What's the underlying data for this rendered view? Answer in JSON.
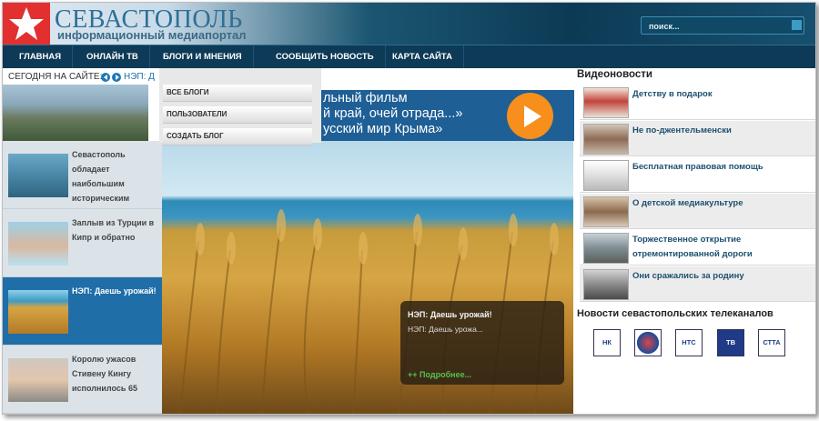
{
  "header": {
    "site_title": "СЕВАСТОПОЛЬ",
    "site_subtitle": "информационный медиапортал",
    "search": {
      "placeholder": "поиск..."
    }
  },
  "nav": {
    "items": [
      {
        "label": "ГЛАВНАЯ"
      },
      {
        "label": "ОНЛАЙН ТВ"
      },
      {
        "label": "БЛОГИ И МНЕНИЯ"
      },
      {
        "label": "СООБЩИТЬ НОВОСТЬ"
      },
      {
        "label": "КАРТА САЙТА"
      }
    ]
  },
  "today": {
    "label": "СЕГОДНЯ НА САЙТЕ:",
    "news": "НЭП: Д"
  },
  "blogs_menu": {
    "items": [
      {
        "label": "ВСЕ БЛОГИ"
      },
      {
        "label": "ПОЛЬЗОВАТЕЛИ"
      },
      {
        "label": "СОЗДАТЬ БЛОГ"
      }
    ]
  },
  "banner": {
    "lines": [
      "льный фильм",
      "й край, очей отрада...»",
      "усский мир Крыма»"
    ]
  },
  "left_news": {
    "items": [
      {
        "title": "Севастополь обладает наибольшим историческим",
        "active": false
      },
      {
        "title": "Заплыв из Турции в Кипр и обратно",
        "active": false
      },
      {
        "title": "НЭП: Даешь урожай!",
        "active": true
      },
      {
        "title": "Королю ужасов Стивену Кингу исполнилось 65",
        "active": false
      }
    ]
  },
  "hero": {
    "caption_title": "НЭП: Даешь урожай!",
    "caption_text": "НЭП: Даешь урожа...",
    "more_link": "++ Подробнее..."
  },
  "video_news": {
    "title": "Видеоновости",
    "items": [
      {
        "title": "Детству в подарок"
      },
      {
        "title": "Не по-джентельменски"
      },
      {
        "title": "Бесплатная правовая помощь"
      },
      {
        "title": "О детской медиакультуре"
      },
      {
        "title": "Торжественное открытие отремонтированной дороги"
      },
      {
        "title": "Они сражались за родину"
      }
    ]
  },
  "tv_channels": {
    "title": "Новости севастопольских телеканалов",
    "logos": [
      {
        "text": "НК"
      },
      {
        "text": ""
      },
      {
        "text": "НТС"
      },
      {
        "text": "ТВ"
      },
      {
        "text": "СТТА"
      }
    ]
  },
  "colors": {
    "nav_bg": "#0d3a56",
    "logo_red": "#e23030",
    "accent_blue": "#1f6ea8",
    "play_orange": "#f68f1c",
    "link_green": "#55c24a"
  }
}
